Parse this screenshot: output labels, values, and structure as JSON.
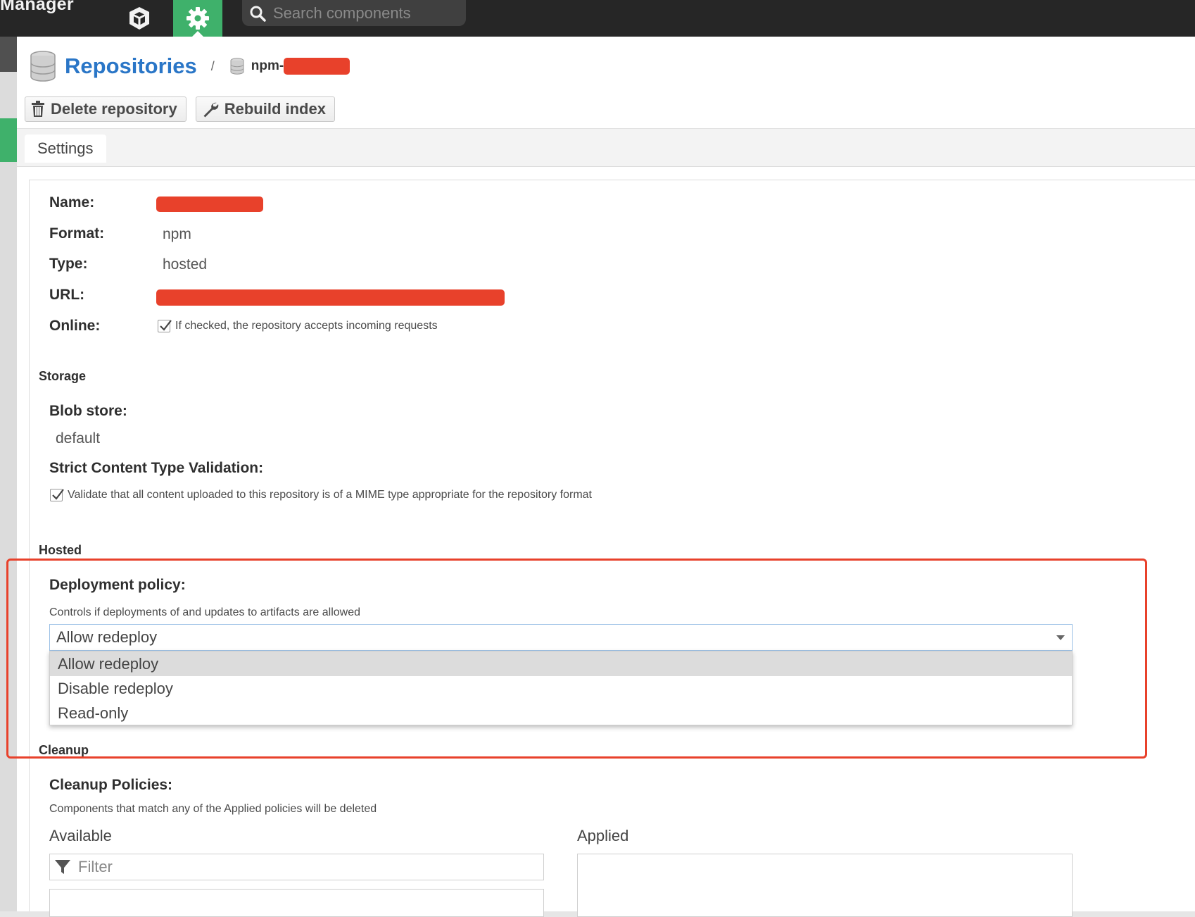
{
  "topbar": {
    "brand": "Manager",
    "search_placeholder": "Search components"
  },
  "breadcrumb": {
    "title": "Repositories",
    "separator": "/",
    "repo_prefix": "npm-"
  },
  "toolbar": {
    "delete_label": "Delete repository",
    "rebuild_label": "Rebuild index"
  },
  "tabs": [
    {
      "label": "Settings"
    }
  ],
  "form": {
    "name_label": "Name:",
    "format_label": "Format:",
    "format_value": "npm",
    "type_label": "Type:",
    "type_value": "hosted",
    "url_label": "URL:",
    "online_label": "Online:",
    "online_help": "If checked, the repository accepts incoming requests",
    "storage_section": "Storage",
    "blob_label": "Blob store:",
    "blob_value": "default",
    "strict_label": "Strict Content Type Validation:",
    "strict_help": "Validate that all content uploaded to this repository is of a MIME type appropriate for the repository format",
    "hosted_section": "Hosted",
    "deploy_label": "Deployment policy:",
    "deploy_help": "Controls if deployments of and updates to artifacts are allowed",
    "deploy_selected": "Allow redeploy",
    "deploy_options": [
      "Allow redeploy",
      "Disable redeploy",
      "Read-only"
    ],
    "cleanup_section": "Cleanup",
    "cleanup_label": "Cleanup Policies:",
    "cleanup_help": "Components that match any of the Applied policies will be deleted",
    "available_label": "Available",
    "applied_label": "Applied",
    "filter_placeholder": "Filter"
  },
  "colors": {
    "topbar": "#262626",
    "accent_green": "#3fb16b",
    "link_blue": "#2a76c7",
    "redaction": "#e8412b",
    "highlight": "#e8412b"
  },
  "icons": [
    "browse-cube-icon",
    "admin-gear-icon",
    "search-icon",
    "database-icon",
    "trash-icon",
    "wrench-icon",
    "checkbox-checked-icon",
    "filter-icon",
    "chevron-down-icon"
  ]
}
